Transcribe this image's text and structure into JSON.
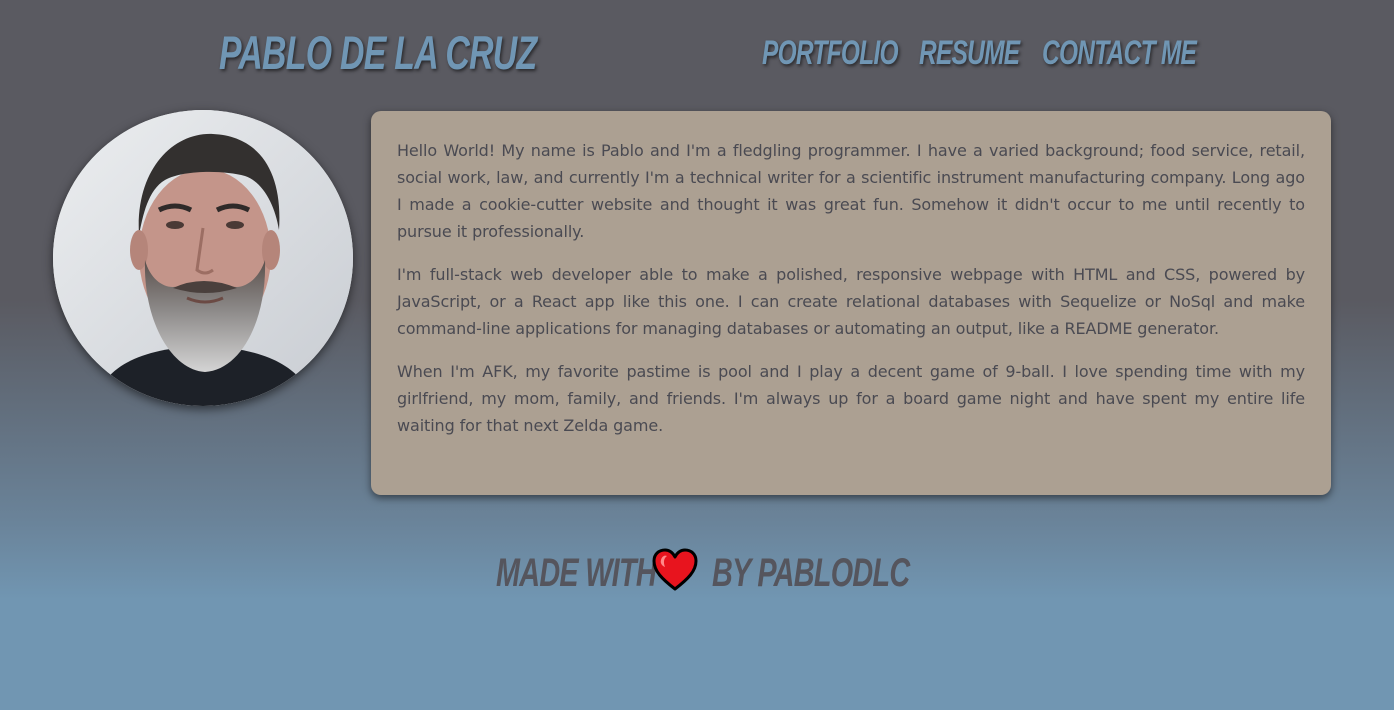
{
  "header": {
    "site_title": "PABLO DE LA CRUZ",
    "nav": [
      {
        "label": "PORTFOLIO"
      },
      {
        "label": "RESUME"
      },
      {
        "label": "CONTACT ME"
      }
    ]
  },
  "profile": {
    "avatar_icon": "profile-photo"
  },
  "about": {
    "paragraphs": [
      "Hello World! My name is Pablo and I'm a fledgling programmer. I have a varied background; food service, retail, social work, law, and currently I'm a technical writer for a scientific instrument manufacturing company. Long ago I made a cookie-cutter website and thought it was great fun. Somehow it didn't occur to me until recently to pursue it professionally.",
      "I'm full-stack web developer able to make a polished, responsive webpage with HTML and CSS, powered by JavaScript, or a React app like this one. I can create relational databases with Sequelize or NoSql and make command-line applications for managing databases or automating an output, like a README generator.",
      "When I'm AFK, my favorite pastime is pool and I play a decent game of 9-ball. I love spending time with my girlfriend, my mom, family, and friends. I'm always up for a board game night and have spent my entire life waiting for that next Zelda game."
    ]
  },
  "footer": {
    "made_with": "MADE WITH",
    "heart_icon": "heart-icon",
    "by": "BY PABLODLC"
  },
  "colors": {
    "accent": "#7096b4",
    "card": "#aca092",
    "text": "#4a4a52",
    "heart": "#e8141e"
  }
}
